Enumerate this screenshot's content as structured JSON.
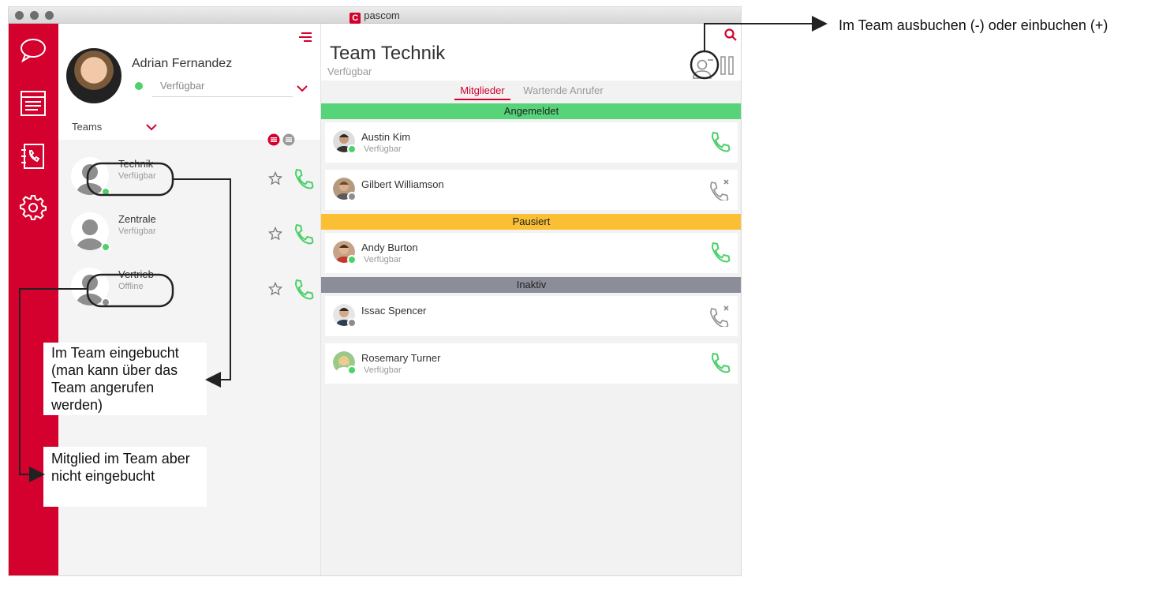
{
  "window": {
    "app_title": "pascom",
    "logo_letter": "C"
  },
  "nav": {
    "items": [
      {
        "icon": "chat-bubble-icon",
        "label": "Chat"
      },
      {
        "icon": "journal-icon",
        "label": "Journal"
      },
      {
        "icon": "phonebook-icon",
        "label": "Phonebook"
      },
      {
        "icon": "gear-icon",
        "label": "Settings"
      }
    ]
  },
  "profile": {
    "name": "Adrian Fernandez",
    "status": "Verfügbar",
    "status_color": "#4cd16b"
  },
  "teams": {
    "label": "Teams",
    "items": [
      {
        "name": "Technik",
        "status": "Verfügbar",
        "dot_color": "#4cd16b"
      },
      {
        "name": "Zentrale",
        "status": "Verfügbar",
        "dot_color": "#4cd16b"
      },
      {
        "name": "Vertrieb",
        "status": "Offline",
        "dot_color": "#8e8e8e"
      }
    ]
  },
  "team_view": {
    "title": "Team Technik",
    "status": "Verfügbar",
    "tabs": [
      {
        "label": "Mitglieder",
        "active": true
      },
      {
        "label": "Wartende Anrufer",
        "active": false
      }
    ],
    "sections": [
      {
        "label": "Angemeldet",
        "color": "#57d37a"
      },
      {
        "label": "Pausiert",
        "color": "#fbbf34"
      },
      {
        "label": "Inaktiv",
        "color": "#8b8e98"
      }
    ],
    "members": [
      {
        "name": "Austin Kim",
        "status": "Verfügbar",
        "dot_color": "#4cd16b",
        "callable": true
      },
      {
        "name": "Gilbert Williamson",
        "status": "",
        "dot_color": "#8e8e8e",
        "callable": false
      },
      {
        "name": "Andy Burton",
        "status": "Verfügbar",
        "dot_color": "#4cd16b",
        "callable": true
      },
      {
        "name": "Issac Spencer",
        "status": "",
        "dot_color": "#8e8e8e",
        "callable": false
      },
      {
        "name": "Rosemary Turner",
        "status": "Verfügbar",
        "dot_color": "#4cd16b",
        "callable": true
      }
    ]
  },
  "annotations": {
    "top_right": "Im Team ausbuchen (-) oder einbuchen (+)",
    "logged_in": "Im Team eingebucht (man kann über das Team angerufen werden)",
    "not_logged_in": "Mitglied im Team aber nicht eingebucht"
  },
  "colors": {
    "brand": "#d4002d",
    "available": "#4cd16b",
    "offline": "#8e8e8e"
  }
}
